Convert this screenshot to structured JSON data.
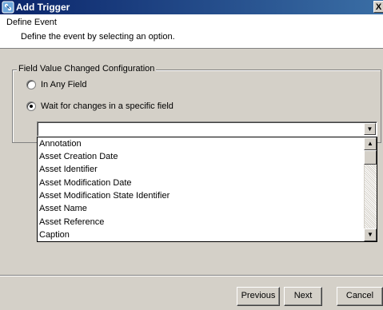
{
  "window": {
    "title": "Add Trigger",
    "close_label": "X"
  },
  "header": {
    "title": "Define Event",
    "description": "Define the event by selecting an option."
  },
  "group": {
    "legend": "Field Value Changed Configuration",
    "options": [
      {
        "label": "In Any Field",
        "checked": false
      },
      {
        "label": "Wait for changes in a specific field",
        "checked": true
      }
    ]
  },
  "field_select": {
    "value": "",
    "arrow": "▼",
    "items": [
      "Annotation",
      "Asset Creation Date",
      "Asset Identifier",
      "Asset Modification Date",
      "Asset Modification State Identifier",
      "Asset Name",
      "Asset Reference",
      "Caption"
    ],
    "scroll_up": "▲",
    "scroll_down": "▼"
  },
  "buttons": {
    "previous": "Previous",
    "next": "Next",
    "cancel": "Cancel"
  }
}
